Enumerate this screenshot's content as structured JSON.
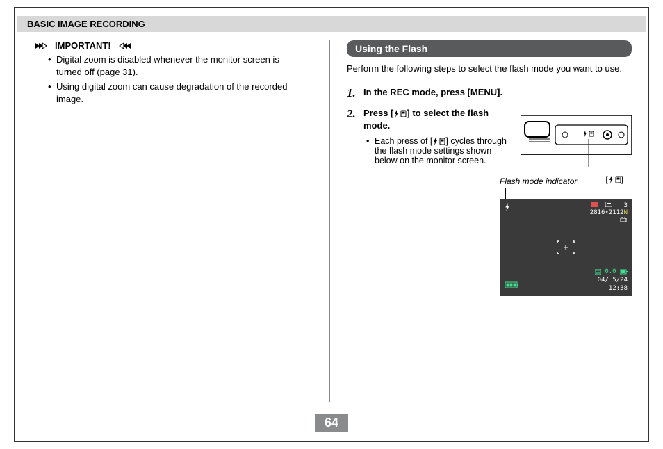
{
  "header": {
    "title": "BASIC IMAGE RECORDING"
  },
  "left": {
    "important_label": "IMPORTANT!",
    "bullets": [
      "Digital zoom is disabled whenever the monitor screen is turned off (page 31).",
      "Using digital zoom can cause degradation of the recorded image."
    ]
  },
  "right": {
    "section_title": "Using the Flash",
    "intro": "Perform the following steps to select the flash mode you want to use.",
    "step1_num": "1.",
    "step1_text": "In the REC mode, press [MENU].",
    "step2_num": "2.",
    "step2_text_a": "Press [",
    "step2_text_b": "] to select the flash mode.",
    "step2_sub_a": "Each press of [",
    "step2_sub_b": "] cycles through the flash mode settings shown below on the monitor screen.",
    "button_label_open": "[",
    "button_label_close": "]",
    "indicator_label": "Flash mode indicator",
    "lcd": {
      "counter": "3",
      "resolution": "2816×2112",
      "quality": "N",
      "ev": "0.0",
      "date": "04/ 5/24",
      "time": "12:38"
    }
  },
  "page_number": "64"
}
